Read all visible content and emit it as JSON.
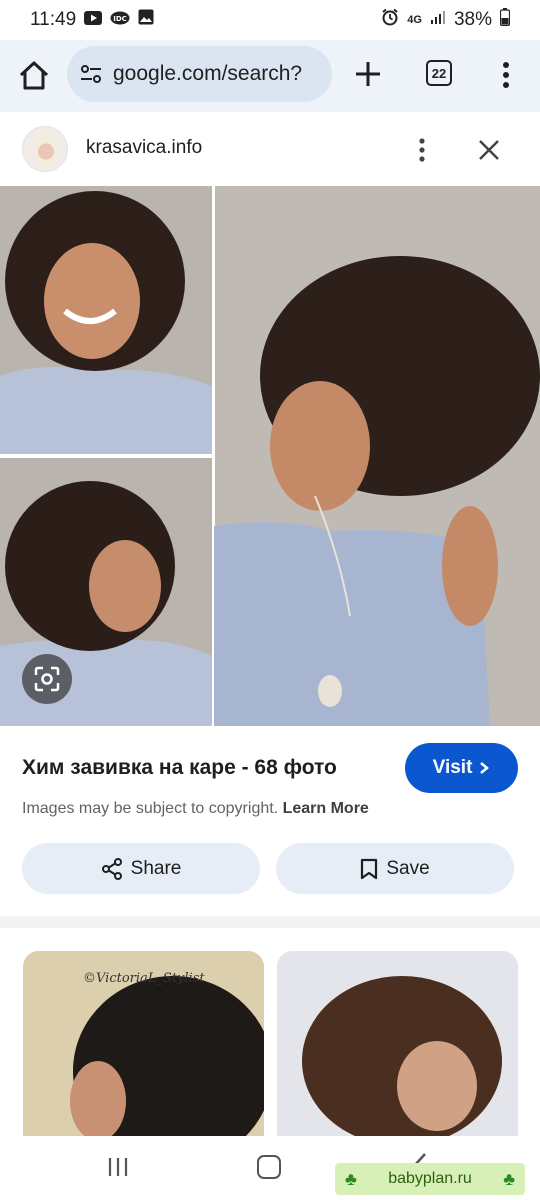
{
  "status_bar": {
    "time": "11:49",
    "network": "4G",
    "battery": "38%",
    "icons": [
      "youtube-icon",
      "idc-icon",
      "gallery-icon",
      "alarm-icon",
      "signal-icon",
      "battery-icon"
    ]
  },
  "browser": {
    "url": "google.com/search?",
    "tab_count": "22",
    "icons": [
      "home-icon",
      "tune-icon",
      "plus-icon",
      "more-vert-icon"
    ]
  },
  "source": {
    "site_name": "krasavica.info",
    "icons": [
      "more-vert-icon",
      "close-icon"
    ]
  },
  "result": {
    "title": "Хим завивка на каре - 68 фото",
    "visit_label": "Visit",
    "copyright_text": "Images may be subject to copyright.",
    "learn_more": "Learn More",
    "share_label": "Share",
    "save_label": "Save",
    "icons": [
      "lens-icon",
      "chevron-right-icon",
      "share-icon",
      "bookmark-icon"
    ]
  },
  "related": {
    "thumb_1_caption": "©VictoriaL_Stylist"
  },
  "watermark": {
    "text": "babyplan.ru"
  },
  "colors": {
    "accent": "#0b57d0",
    "toolbar_bg": "#eef3fa",
    "omnibox_bg": "#dbe5f1",
    "pill_bg": "#e7edf6"
  }
}
